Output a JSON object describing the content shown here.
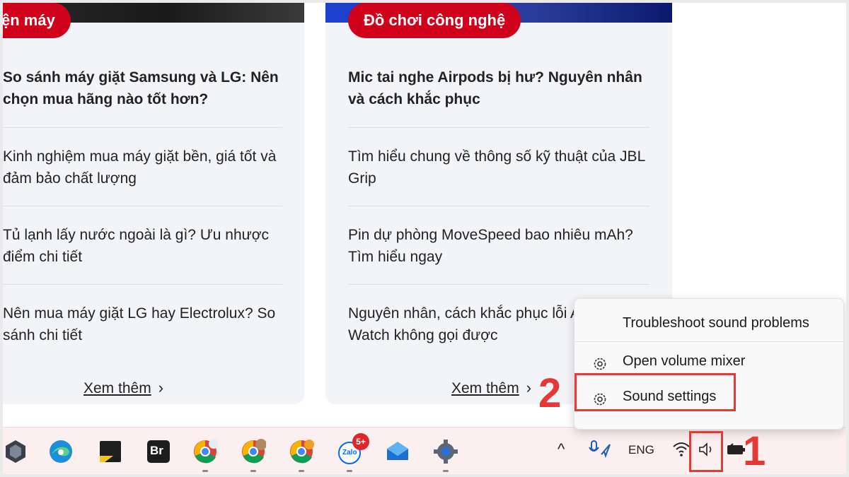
{
  "cards": {
    "left": {
      "category": "Điện máy",
      "articles": [
        "So sánh máy giặt Samsung và LG: Nên chọn mua hãng nào tốt hơn?",
        "Kinh nghiệm mua máy giặt bền, giá tốt và đảm bảo chất lượng",
        "Tủ lạnh lấy nước ngoài là gì? Ưu nhược điểm chi tiết",
        "Nên mua máy giặt LG hay Electrolux? So sánh chi tiết"
      ],
      "see_more": "Xem thêm"
    },
    "right": {
      "category": "Đồ chơi công nghệ",
      "articles": [
        "Mic tai nghe Airpods bị hư? Nguyên nhân và cách khắc phục",
        "Tìm hiểu chung về thông số kỹ thuật của JBL Grip",
        "Pin dự phòng MoveSpeed bao nhiêu mAh? Tìm hiểu ngay",
        "Nguyên nhân, cách khắc phục lỗi Apple Watch không gọi được"
      ],
      "see_more": "Xem thêm"
    }
  },
  "context_menu": {
    "items": [
      {
        "label": "Troubleshoot sound problems",
        "icon": "none"
      },
      {
        "label": "Open volume mixer",
        "icon": "gear-icon"
      },
      {
        "label": "Sound settings",
        "icon": "gear-icon"
      }
    ]
  },
  "taskbar": {
    "apps": [
      "app-hexagon",
      "edge",
      "sticky-notes",
      "bridge",
      "chrome-1",
      "chrome-2",
      "chrome-3",
      "zalo",
      "mail",
      "settings"
    ],
    "bridge_label": "Br",
    "zalo_label": "Zalo",
    "zalo_badge": "5+",
    "tray_language": "ENG"
  },
  "annotations": {
    "step1": "1",
    "step2": "2"
  },
  "colors": {
    "accent_red": "#d0021b",
    "annotation_red": "#e53935",
    "taskbar_bg": "#fbeff0"
  }
}
